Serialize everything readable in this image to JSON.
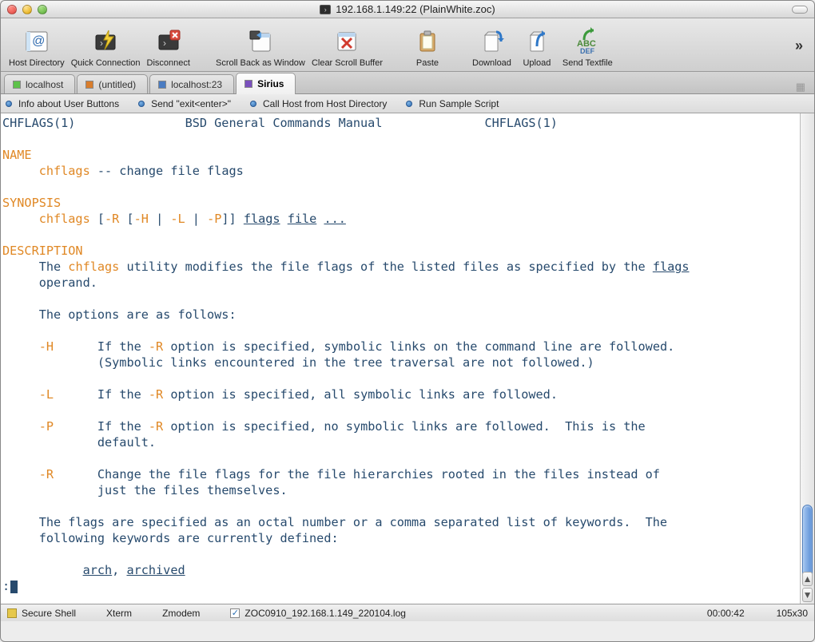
{
  "window": {
    "title": "192.168.1.149:22 (PlainWhite.zoc)"
  },
  "toolbar": {
    "items": [
      {
        "label": "Host Directory"
      },
      {
        "label": "Quick Connection"
      },
      {
        "label": "Disconnect"
      },
      {
        "label": "Scroll Back as Window"
      },
      {
        "label": "Clear Scroll Buffer"
      },
      {
        "label": "Paste"
      },
      {
        "label": "Download"
      },
      {
        "label": "Upload"
      },
      {
        "label": "Send Textfile"
      }
    ]
  },
  "tabs": [
    {
      "label": "localhost",
      "color": "green",
      "active": false
    },
    {
      "label": "(untitled)",
      "color": "orange",
      "active": false
    },
    {
      "label": "localhost:23",
      "color": "blue",
      "active": false
    },
    {
      "label": "Sirius",
      "color": "purple",
      "active": true
    }
  ],
  "userbar": [
    {
      "label": "Info about User Buttons"
    },
    {
      "label": "Send \"exit<enter>\""
    },
    {
      "label": "Call Host from Host Directory"
    },
    {
      "label": "Run Sample Script"
    }
  ],
  "terminal": {
    "header_left": "CHFLAGS(1)",
    "header_center": "BSD General Commands Manual",
    "header_right": "CHFLAGS(1)",
    "name_heading": "NAME",
    "name_cmd": "chflags",
    "name_rest": " -- change file flags",
    "synopsis_heading": "SYNOPSIS",
    "syn_cmd": "chflags",
    "syn_start": " [",
    "syn_R": "-R",
    "syn_mid1": " [",
    "syn_H": "-H",
    "syn_pipe1": " | ",
    "syn_L": "-L",
    "syn_pipe2": " | ",
    "syn_P": "-P",
    "syn_close": "]] ",
    "syn_flags": "flags",
    "syn_space": " ",
    "syn_file": "file",
    "syn_dots": "...",
    "desc_heading": "DESCRIPTION",
    "desc_l1a": "     The ",
    "desc_l1b": "chflags",
    "desc_l1c": " utility modifies the file flags of the listed files as specified by the ",
    "desc_l1d": "flags",
    "desc_l2": "     operand.",
    "desc_opts": "     The options are as follows:",
    "opt_H_flag": "-H",
    "opt_H_t1a": "If the ",
    "opt_H_t1b": "-R",
    "opt_H_t1c": " option is specified, symbolic links on the command line are followed.",
    "opt_H_t2": "(Symbolic links encountered in the tree traversal are not followed.)",
    "opt_L_flag": "-L",
    "opt_L_t1a": "If the ",
    "opt_L_t1b": "-R",
    "opt_L_t1c": " option is specified, all symbolic links are followed.",
    "opt_P_flag": "-P",
    "opt_P_t1a": "If the ",
    "opt_P_t1b": "-R",
    "opt_P_t1c": " option is specified, no symbolic links are followed.  This is the",
    "opt_P_t2": "default.",
    "opt_R_flag": "-R",
    "opt_R_t1": "Change the file flags for the file hierarchies rooted in the files instead of",
    "opt_R_t2": "just the files themselves.",
    "flags_l1": "     The flags are specified as an octal number or a comma separated list of keywords.  The",
    "flags_l2": "     following keywords are currently defined:",
    "kw_arch": "arch",
    "kw_sep": ", ",
    "kw_archived": "archived",
    "prompt": ":"
  },
  "status": {
    "shell": "Secure Shell",
    "emu": "Xterm",
    "proto": "Zmodem",
    "logfile": "ZOC0910_192.168.1.149_220104.log",
    "time": "00:00:42",
    "size": "105x30"
  }
}
